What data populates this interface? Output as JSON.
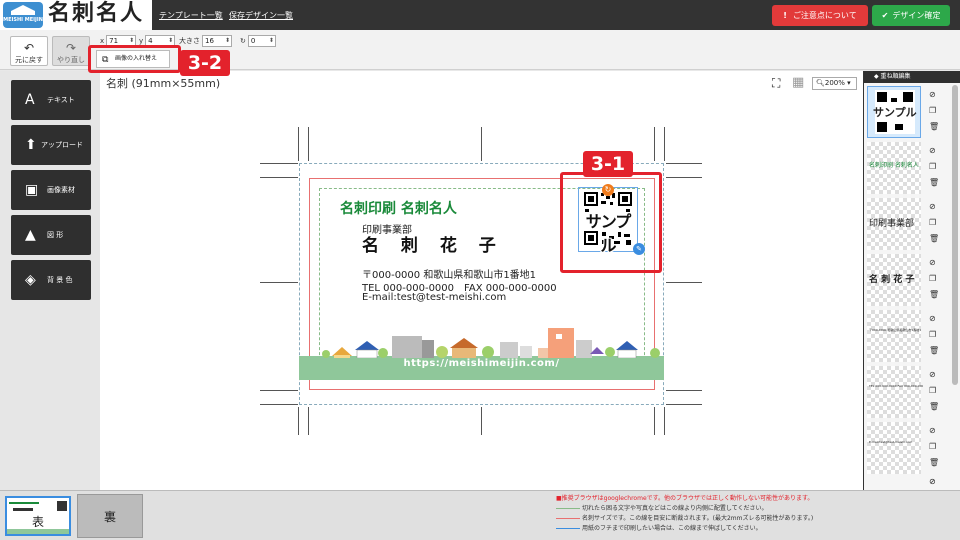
{
  "header": {
    "logo_text": "名刺名人",
    "logo_sub": "MEISHI MEIJIN",
    "links": [
      "テンプレート一覧",
      "保存デザイン一覧"
    ],
    "caution_button": "ご注意点について",
    "confirm_button": "デザイン確定"
  },
  "toolbar": {
    "undo_label": "元に戻す",
    "redo_label": "やり直し",
    "fields": [
      {
        "label": "x",
        "value": "71"
      },
      {
        "label": "y",
        "value": "4"
      },
      {
        "label": "大きさ",
        "value": "16"
      },
      {
        "label": "",
        "value": "0"
      }
    ],
    "swap_image_label": "画像の入れ替え"
  },
  "callouts": {
    "first": "3-1",
    "second": "3-2"
  },
  "left_menu": [
    {
      "icon": "text-icon",
      "label": "テキスト"
    },
    {
      "icon": "upload-icon",
      "label": "アップロード"
    },
    {
      "icon": "image-icon",
      "label": "画像素材"
    },
    {
      "icon": "shapes-icon",
      "label": "図 形"
    },
    {
      "icon": "paint-bucket-icon",
      "label": "背 景 色"
    }
  ],
  "canvas": {
    "title": "名刺 (91mm×55mm)",
    "zoom": "200%"
  },
  "card": {
    "heading": "名刺印刷 名刺名人",
    "department": "印刷事業部",
    "name": "名 刺 花 子",
    "address": "〒000-0000 和歌山県和歌山市1番地1",
    "tel_fax": "TEL 000-000-0000　FAX 000-000-0000",
    "email": "E-mail:test@test-meishi.com",
    "url": "https://meishimeijin.com/",
    "qr_overlay": "サンプル",
    "accent_color": "#1a8a3a"
  },
  "layers": {
    "title": "重ね順編集",
    "items": [
      {
        "text": "サンプル",
        "type": "qr"
      },
      {
        "text": "名刺印刷 名刺名人",
        "type": "text"
      },
      {
        "text": "印刷事業部",
        "type": "text"
      },
      {
        "text": "名 刺 花 子",
        "type": "text"
      },
      {
        "text": "〒000-0000 和歌山県和歌山市1番地1",
        "type": "text"
      },
      {
        "text": "TEL 000-000-0000 FAX 000-000-0000",
        "type": "text"
      },
      {
        "text": "E-mail:test@test-meishi.com",
        "type": "text"
      }
    ]
  },
  "pages": {
    "front": "表",
    "back": "裏"
  },
  "legend": {
    "warning": "■推奨ブラウザはgooglechromeです。他のブラウザでは正しく動作しない可能性があります。",
    "line1": "切れたら困る文字や写真などはこの線より内側に配置してください。",
    "line2": "名刺サイズです。この線を目安に断裁されます。(最大2mmズレる可能性があります。)",
    "line3": "用紙のフチまで印刷したい場合は、この線まで伸ばしてください。"
  }
}
